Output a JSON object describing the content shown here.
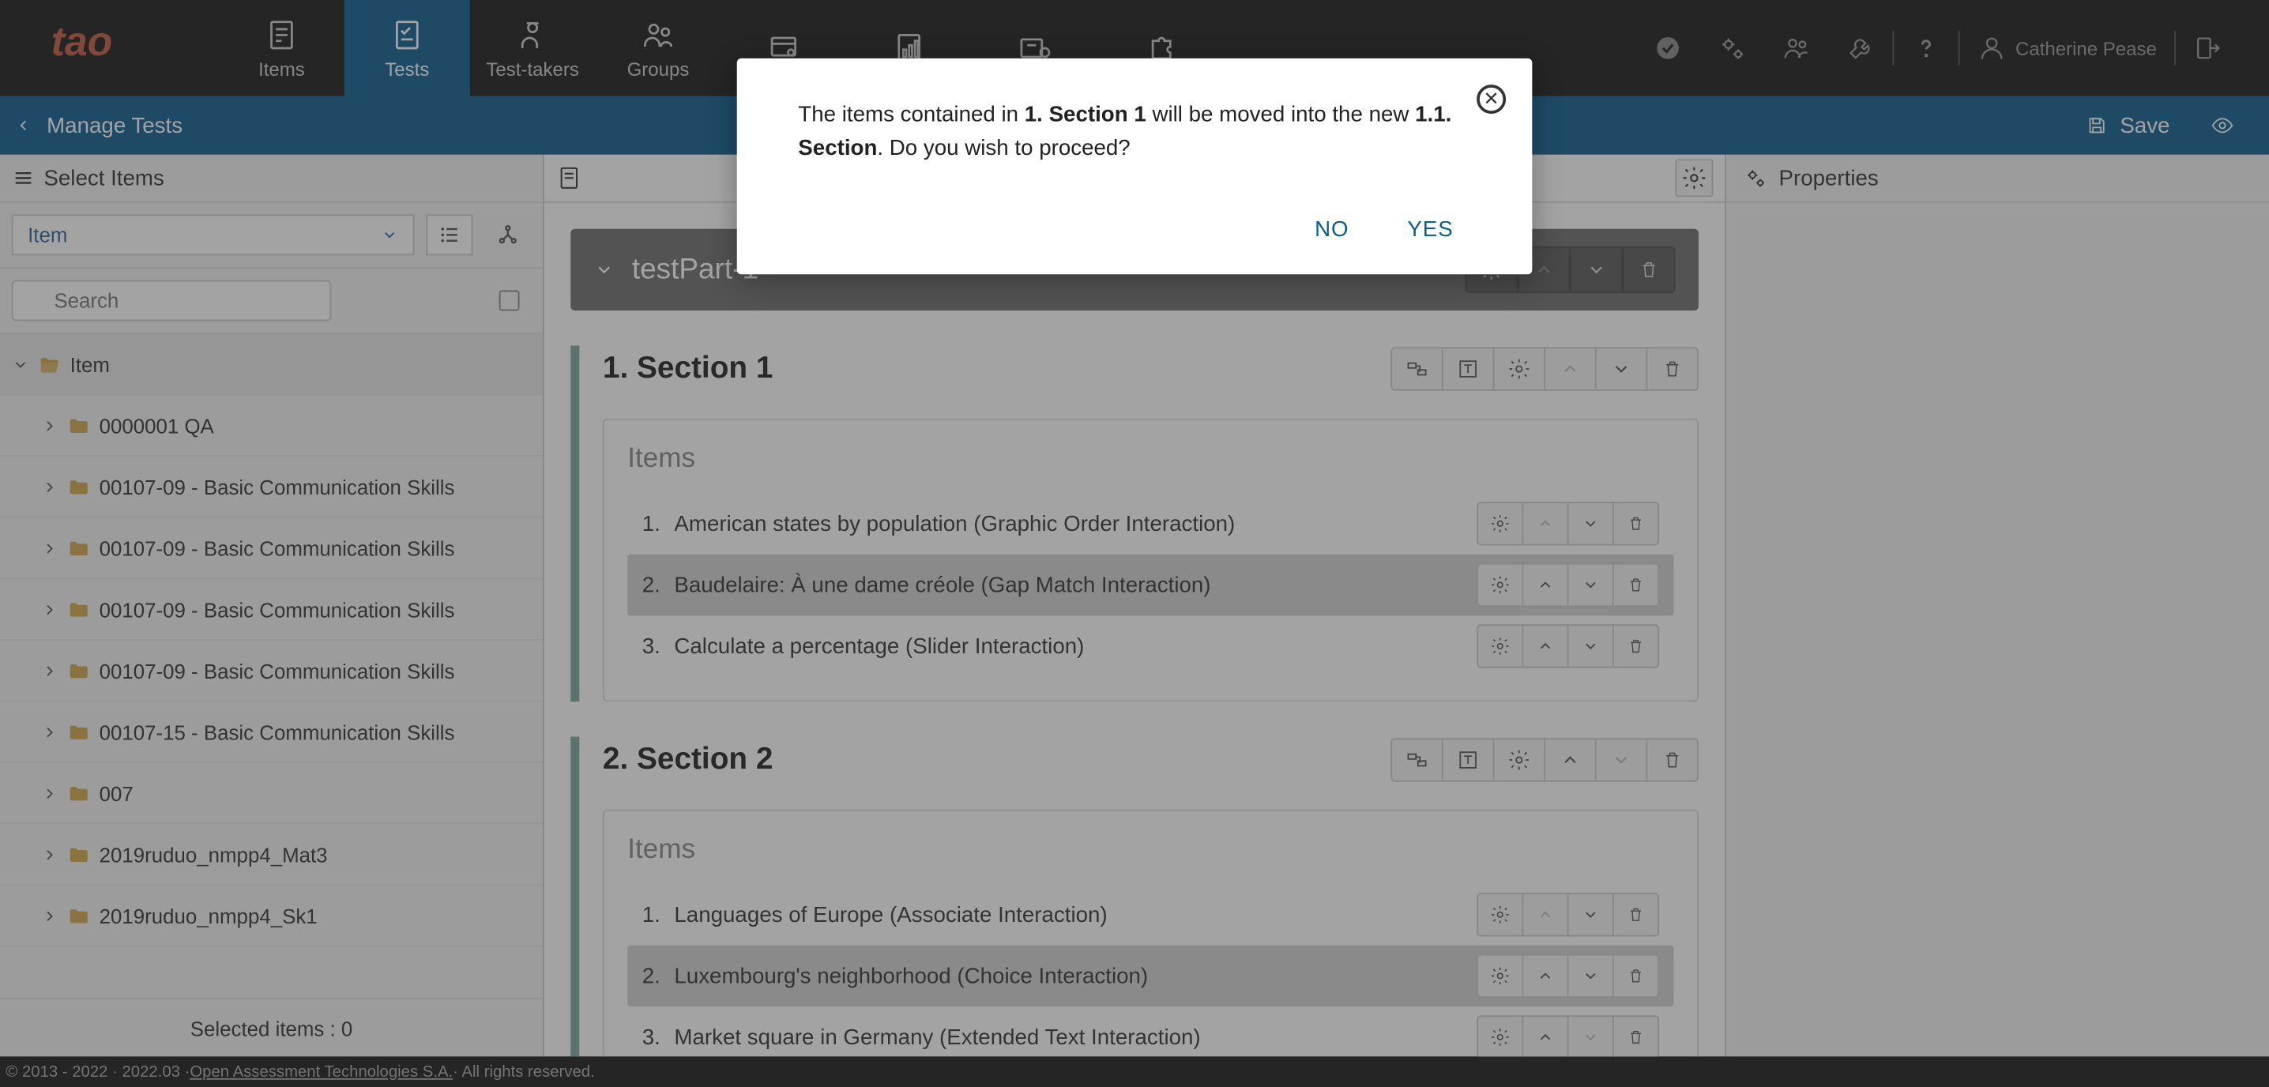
{
  "nav": {
    "items": "Items",
    "tests": "Tests",
    "testTakers": "Test-takers",
    "groups": "Groups",
    "user": "Catherine Pease"
  },
  "secbar": {
    "title": "Manage Tests",
    "save": "Save"
  },
  "sidebar": {
    "select": "Select Items",
    "dropdown": "Item",
    "searchPlaceholder": "Search",
    "root": "Item",
    "folders": [
      "0000001 QA",
      "00107-09 - Basic Communication Skills",
      "00107-09 - Basic Communication Skills",
      "00107-09 - Basic Communication Skills",
      "00107-09 - Basic Communication Skills",
      "00107-15 - Basic Communication Skills",
      "007",
      "2019ruduo_nmpp4_Mat3",
      "2019ruduo_nmpp4_Sk1"
    ],
    "footer": "Selected items : 0"
  },
  "center": {
    "part": "testPart-1",
    "section1": {
      "title": "1. Section 1",
      "itemsLabel": "Items",
      "items": [
        {
          "n": "1.",
          "t": "American states by population (Graphic Order Interaction)"
        },
        {
          "n": "2.",
          "t": "Baudelaire: À une dame créole (Gap Match Interaction)"
        },
        {
          "n": "3.",
          "t": "Calculate a percentage (Slider Interaction)"
        }
      ]
    },
    "section2": {
      "title": "2. Section 2",
      "itemsLabel": "Items",
      "items": [
        {
          "n": "1.",
          "t": "Languages of Europe (Associate Interaction)"
        },
        {
          "n": "2.",
          "t": "Luxembourg's neighborhood (Choice Interaction)"
        },
        {
          "n": "3.",
          "t": "Market square in Germany (Extended Text Interaction)"
        }
      ]
    }
  },
  "right": {
    "title": "Properties"
  },
  "footer": {
    "copyright": "© 2013 - 2022 · 2022.03 · ",
    "link": "Open Assessment Technologies S.A.",
    "rights": " · All rights reserved."
  },
  "modal": {
    "pre": "The items contained in ",
    "b1": "1. Section 1",
    "mid": " will be moved into the new ",
    "b2": "1.1. Section",
    "post": ". Do you wish to proceed?",
    "no": "NO",
    "yes": "YES"
  }
}
